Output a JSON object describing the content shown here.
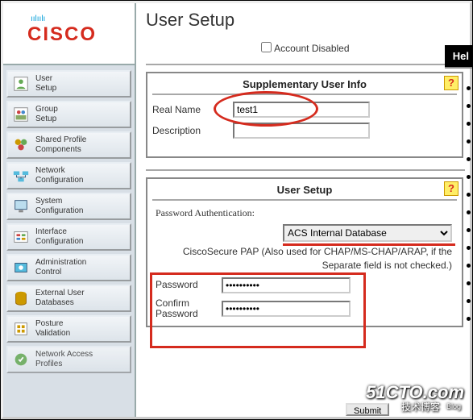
{
  "brand": {
    "bars": "ıılıılı",
    "name": "CISCO"
  },
  "nav": [
    {
      "label": "User\nSetup",
      "icon": "user"
    },
    {
      "label": "Group\nSetup",
      "icon": "group"
    },
    {
      "label": "Shared Profile\nComponents",
      "icon": "components"
    },
    {
      "label": "Network\nConfiguration",
      "icon": "network"
    },
    {
      "label": "System\nConfiguration",
      "icon": "system"
    },
    {
      "label": "Interface\nConfiguration",
      "icon": "interface"
    },
    {
      "label": "Administration\nControl",
      "icon": "admin"
    },
    {
      "label": "External User\nDatabases",
      "icon": "database"
    },
    {
      "label": "Posture\nValidation",
      "icon": "posture"
    },
    {
      "label": "Network Access\nProfiles",
      "icon": "profiles"
    }
  ],
  "page_title": "User Setup",
  "account_disabled_label": "Account Disabled",
  "panel_supp": {
    "title": "Supplementary User Info",
    "real_name_label": "Real Name",
    "real_name_value": "test1",
    "description_label": "Description",
    "description_value": ""
  },
  "panel_setup": {
    "title": "User Setup",
    "pw_auth_label": "Password Authentication:",
    "auth_selected": "ACS Internal Database",
    "pap_note": "CiscoSecure PAP (Also used for CHAP/MS-CHAP/ARAP, if the Separate field is not checked.)",
    "password_label": "Password",
    "password_value": "••••••••••",
    "confirm_label": "Confirm Password",
    "confirm_value": "••••••••••"
  },
  "help_tab": "Hel",
  "submit_stub": "Submit",
  "watermark": {
    "big": "51CTO.com",
    "sub": "技术博客",
    "blog": "Blog"
  }
}
